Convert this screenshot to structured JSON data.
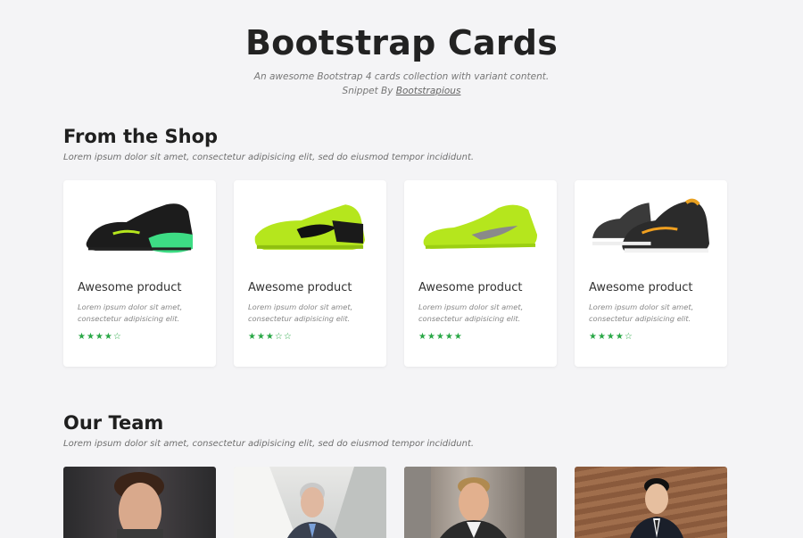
{
  "hero": {
    "title": "Bootstrap Cards",
    "subtitle": "An awesome Bootstrap 4 cards collection with variant content.",
    "snippet_prefix": "Snippet By ",
    "snippet_link": "Bootstrapious"
  },
  "shop": {
    "heading": "From the Shop",
    "description": "Lorem ipsum dolor sit amet, consectetur adipisicing elit, sed do eiusmod tempor incididunt.",
    "cards": [
      {
        "title": "Awesome product",
        "text": "Lorem ipsum dolor sit amet, consectetur adipisicing elit.",
        "stars": "★★★★☆",
        "rating": 4,
        "image": "black-green-sneaker"
      },
      {
        "title": "Awesome product",
        "text": "Lorem ipsum dolor sit amet, consectetur adipisicing elit.",
        "stars": "★★★☆☆",
        "rating": 3,
        "image": "neon-black-sneaker"
      },
      {
        "title": "Awesome product",
        "text": "Lorem ipsum dolor sit amet, consectetur adipisicing elit.",
        "stars": "★★★★★",
        "rating": 5,
        "image": "neon-tennis-sneaker"
      },
      {
        "title": "Awesome product",
        "text": "Lorem ipsum dolor sit amet, consectetur adipisicing elit.",
        "stars": "★★★★☆",
        "rating": 4,
        "image": "grey-orange-sneaker"
      }
    ]
  },
  "team": {
    "heading": "Our Team",
    "description": "Lorem ipsum dolor sit amet, consectetur adipisicing elit, sed do eiusmod tempor incididunt.",
    "members": [
      {
        "image": "portrait-young-man"
      },
      {
        "image": "portrait-grey-haired-man"
      },
      {
        "image": "portrait-smiling-man"
      },
      {
        "image": "portrait-man-in-suit"
      }
    ]
  },
  "colors": {
    "background": "#f4f4f6",
    "star": "#28a745",
    "neon": "#b5e61d"
  }
}
